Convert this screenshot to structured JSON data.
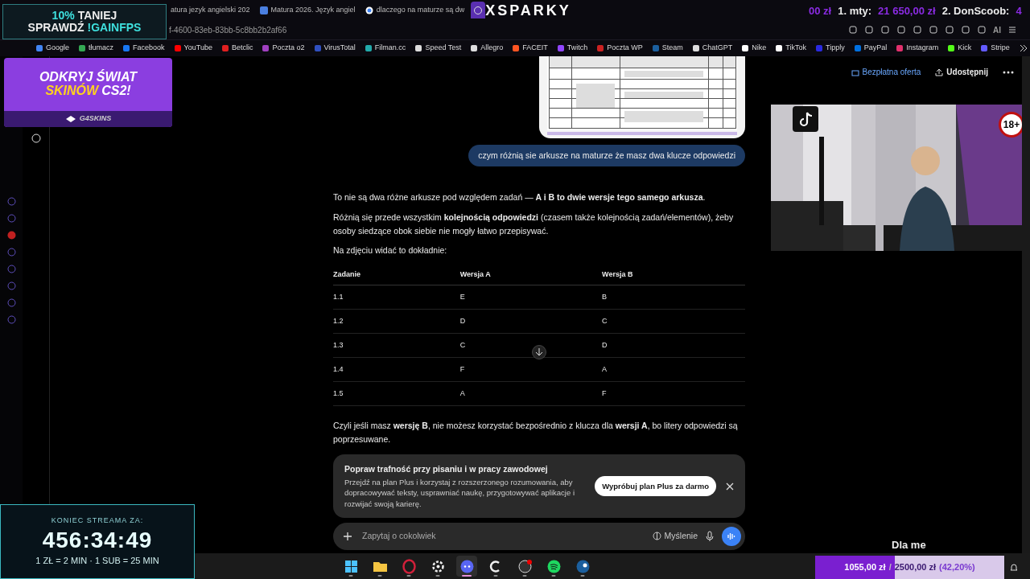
{
  "browser": {
    "tabs": [
      {
        "title": "atura jezyk angielski 202",
        "selected": false
      },
      {
        "title": "Matura 2026. Język angiel",
        "selected": false
      },
      {
        "title": "dlaczego na maturze są dw",
        "selected": false
      },
      {
        "selected": true
      }
    ],
    "address": "f-4600-83eb-83bb-5c8bb2b2af66",
    "bookmarks": [
      "Google",
      "tłumacz",
      "Facebook",
      "YouTube",
      "Betclic",
      "Poczta o2",
      "VirusTotal",
      "Filman.cc",
      "Speed Test",
      "Allegro",
      "FACEIT",
      "Twitch",
      "Poczta WP",
      "Steam",
      "ChatGPT",
      "Nike",
      "TikTok",
      "Tipply",
      "PayPal",
      "Instagram",
      "Kick",
      "Stripe"
    ],
    "toolbar_label": "AI"
  },
  "chat": {
    "actions": [
      "Bezpłatna oferta",
      "Udostępnij"
    ],
    "attachment": {
      "kind": "picture"
    },
    "user_message": "czym różnią sie arkusze na maturze że masz dwa klucze odpowiedzi",
    "paragraphs": [
      "To nie są dwa różne arkusze pod względem zadań — **A i B to dwie wersje tego samego arkusza**.",
      "Różnią się przede wszystkim **kolejnością odpowiedzi** (czasem także kolejnością zadań/elementów), żeby osoby siedzące obok siebie nie mogły łatwo przepisywać.",
      "Na zdjęciu widać to dokładnie:"
    ],
    "table": {
      "columns": [
        "Zadanie",
        "Wersja A",
        "Wersja B"
      ],
      "rows": [
        [
          "1.1",
          "E",
          "B"
        ],
        [
          "1.2",
          "D",
          "C"
        ],
        [
          "1.3",
          "C",
          "D"
        ],
        [
          "1.4",
          "F",
          "A"
        ],
        [
          "1.5",
          "A",
          "F"
        ]
      ]
    },
    "closing": "Czyli jeśli masz **wersję B**, nie możesz korzystać bezpośrednio z klucza dla **wersji A**, bo litery odpowiedzi są poprzesuwane.",
    "promo": {
      "title": "Popraw trafność przy pisaniu i w pracy zawodowej",
      "body": "Przejdź na plan Plus i korzystaj z rozszerzonego rozumowania, aby dopracowywać teksty, usprawniać naukę, przygotowywać aplikacje i rozwijać swoją karierę.",
      "button": "Wypróbuj plan Plus za darmo"
    },
    "composer": {
      "placeholder": "Zapytaj o cokolwiek",
      "mode": "Myślenie"
    }
  },
  "taskbar": [
    {
      "kind": "windows",
      "selected": false
    },
    {
      "kind": "folder",
      "selected": false
    },
    {
      "kind": "opera",
      "selected": false
    },
    {
      "kind": "gear",
      "selected": false
    },
    {
      "kind": "discord",
      "selected": true
    },
    {
      "kind": "g",
      "selected": false
    },
    {
      "kind": "obs",
      "selected": false
    },
    {
      "kind": "spotify",
      "selected": false
    },
    {
      "kind": "steam",
      "selected": false
    }
  ],
  "overlays": {
    "promo_top": {
      "pct": "10%",
      "word": "TANIEJ",
      "check": "SPRAWDŹ",
      "code": "!GAINFPS"
    },
    "skins_ad": {
      "line1": "ODKRYJ ŚWIAT",
      "line2a": "SKINÓW",
      "line2b": "CS2!",
      "brand": "G4SKINS"
    },
    "logo": "XSPARKY",
    "leaderboard": [
      {
        "amount": "00 zł"
      },
      {
        "label": "1. mty:",
        "amount": "21 650,00 zł"
      },
      {
        "label": "2. DonScoob:",
        "amount": "4"
      }
    ],
    "timer": {
      "title": "KONIEC STREAMA ZA:",
      "time": "456:34:49",
      "rules": "1 ZŁ = 2 MIN · 1 SUB = 25 MIN"
    },
    "webcam": {
      "kind": "picture",
      "badge": "18+"
    },
    "caption": "Dla me",
    "goal": {
      "current": "1055,00 zł",
      "separator": "/",
      "target": "2500,00 zł",
      "percent": "(42,20%)",
      "level": 0.422
    }
  }
}
